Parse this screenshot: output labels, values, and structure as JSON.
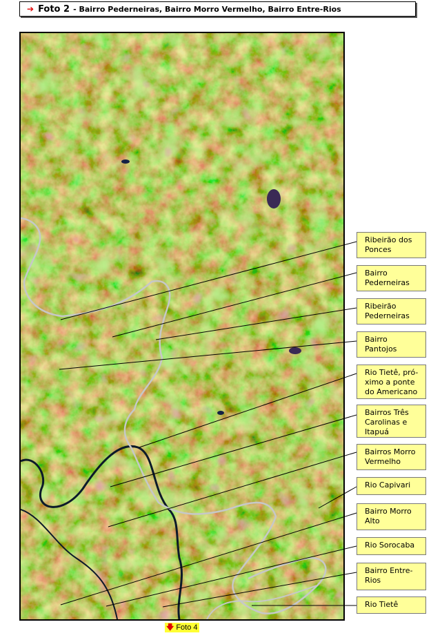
{
  "header": {
    "arrow_icon": "red-right-arrow",
    "title": "Foto 2",
    "subtitle": "- Bairro Pederneiras, Bairro Morro Vermelho, Bairro Entre-Rios"
  },
  "labels": [
    {
      "id": "ribeirao-dos-ponces",
      "text": "Ribeirão dos Ponces"
    },
    {
      "id": "bairro-pederneiras",
      "text": "Bairro Pederneiras"
    },
    {
      "id": "ribeirao-pederneiras",
      "text": "Ribeirão Pederneiras"
    },
    {
      "id": "bairro-pantojos",
      "text": "Bairro Pantojos"
    },
    {
      "id": "rio-tiete-ponte",
      "text": "Rio Tietê, pró- ximo a ponte do Americano"
    },
    {
      "id": "bairros-tres-carolinas",
      "text": "Bairros Três Carolinas e Itapuá"
    },
    {
      "id": "bairros-morro-vermelho",
      "text": "Bairros Morro Vermelho"
    },
    {
      "id": "rio-capivari",
      "text": "Rio Capivari"
    },
    {
      "id": "bairro-morro-alto",
      "text": "Bairro Morro Alto"
    },
    {
      "id": "rio-sorocaba",
      "text": "Rio Sorocaba"
    },
    {
      "id": "bairro-entre-rios",
      "text": "Bairro Entre-Rios"
    },
    {
      "id": "rio-tiete",
      "text": "Rio Tietê"
    }
  ],
  "nav": {
    "down_arrow_icon": "red-down-arrow",
    "foto4_label": "Foto 4"
  },
  "colors": {
    "label_bg": "#ffff99",
    "nav_bg": "#ffff33",
    "arrow": "#e00000",
    "map_base": "#9aa544"
  }
}
